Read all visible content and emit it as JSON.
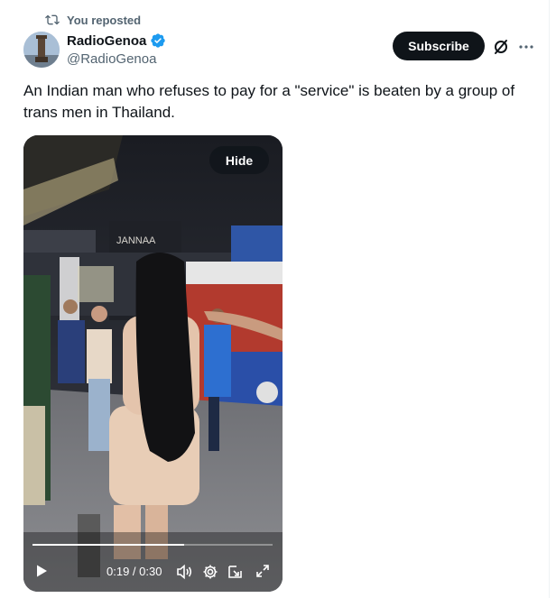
{
  "repost": {
    "label": "You reposted",
    "icon": "repost-icon"
  },
  "author": {
    "display_name": "RadioGenoa",
    "handle": "@RadioGenoa",
    "verified": true,
    "avatar": "avatar-image"
  },
  "actions": {
    "subscribe_label": "Subscribe",
    "grok_icon": "grok-icon",
    "more_icon": "more-icon"
  },
  "tweet": {
    "text": "An Indian man who refuses to pay for a \"service\" is beaten by a group of trans men in Thailand."
  },
  "video": {
    "hide_label": "Hide",
    "current_time": "0:19",
    "duration": "0:30",
    "time_display": "0:19 / 0:30",
    "progress": 0.63,
    "controls": [
      "play-icon",
      "volume-icon",
      "settings-icon",
      "picture-in-picture-icon",
      "fullscreen-icon"
    ]
  },
  "colors": {
    "primary_text": "#0f1419",
    "secondary_text": "#536471",
    "verified_blue": "#1d9bf0",
    "button_black": "#0f1419"
  }
}
